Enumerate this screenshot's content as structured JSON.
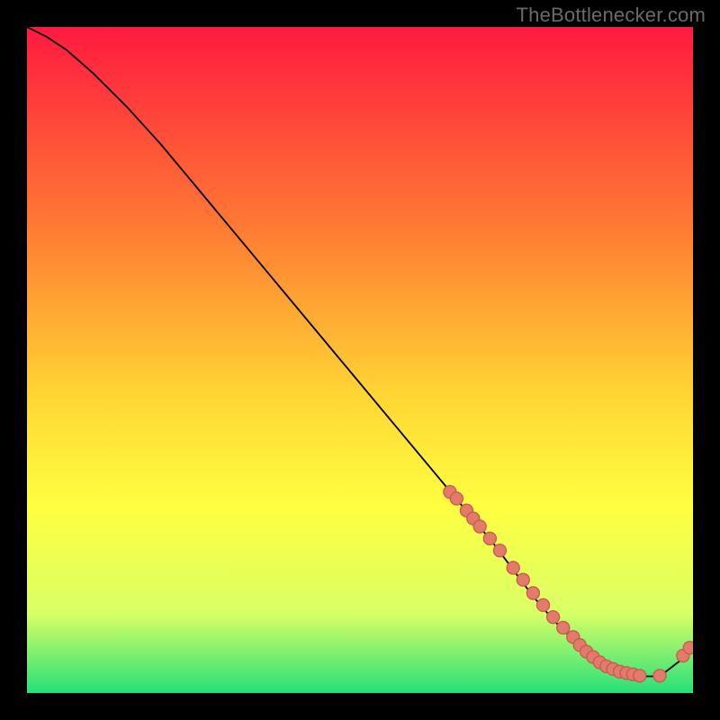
{
  "attribution": "TheBottlenecker.com",
  "colors": {
    "frame_bg": "#000000",
    "gradient_top": "#ff1a40",
    "gradient_mid1": "#ff7a33",
    "gradient_mid2": "#ffd533",
    "gradient_mid3": "#ffff40",
    "gradient_mid4": "#d9ff66",
    "gradient_bottom": "#26e07a",
    "curve": "#000000",
    "dot_fill": "#e37b6c",
    "dot_stroke": "#c95a4e"
  },
  "chart_data": {
    "type": "line",
    "title": "",
    "xlabel": "",
    "ylabel": "",
    "xlim": [
      0,
      100
    ],
    "ylim": [
      0,
      100
    ],
    "curve": {
      "x": [
        0,
        3,
        6,
        10,
        15,
        20,
        25,
        30,
        35,
        40,
        45,
        50,
        55,
        60,
        65,
        70,
        73,
        76,
        79,
        82,
        85,
        88,
        90,
        92,
        95,
        98,
        100
      ],
      "y": [
        100,
        98.5,
        96.5,
        93,
        88,
        82.5,
        76.5,
        70.5,
        64.5,
        58.5,
        52.5,
        46.5,
        40.5,
        34.5,
        28.5,
        22.5,
        18.5,
        14.5,
        11,
        8,
        5.5,
        3.5,
        2.8,
        2.5,
        2.5,
        4.8,
        7.5
      ]
    },
    "dots": {
      "x": [
        63.5,
        64.5,
        66,
        67,
        68,
        69.5,
        71,
        73,
        74.5,
        76,
        77.5,
        79,
        80.5,
        82,
        83,
        84,
        85,
        86,
        87,
        88,
        89,
        90,
        91,
        92,
        95,
        98.5,
        99.5
      ],
      "y": [
        30.2,
        29.2,
        27.4,
        26.2,
        25,
        23.2,
        21.4,
        18.8,
        17,
        15,
        13.2,
        11.4,
        9.8,
        8.4,
        7.2,
        6.2,
        5.4,
        4.6,
        4,
        3.6,
        3.2,
        3,
        2.8,
        2.6,
        2.6,
        5.6,
        6.8
      ]
    }
  }
}
